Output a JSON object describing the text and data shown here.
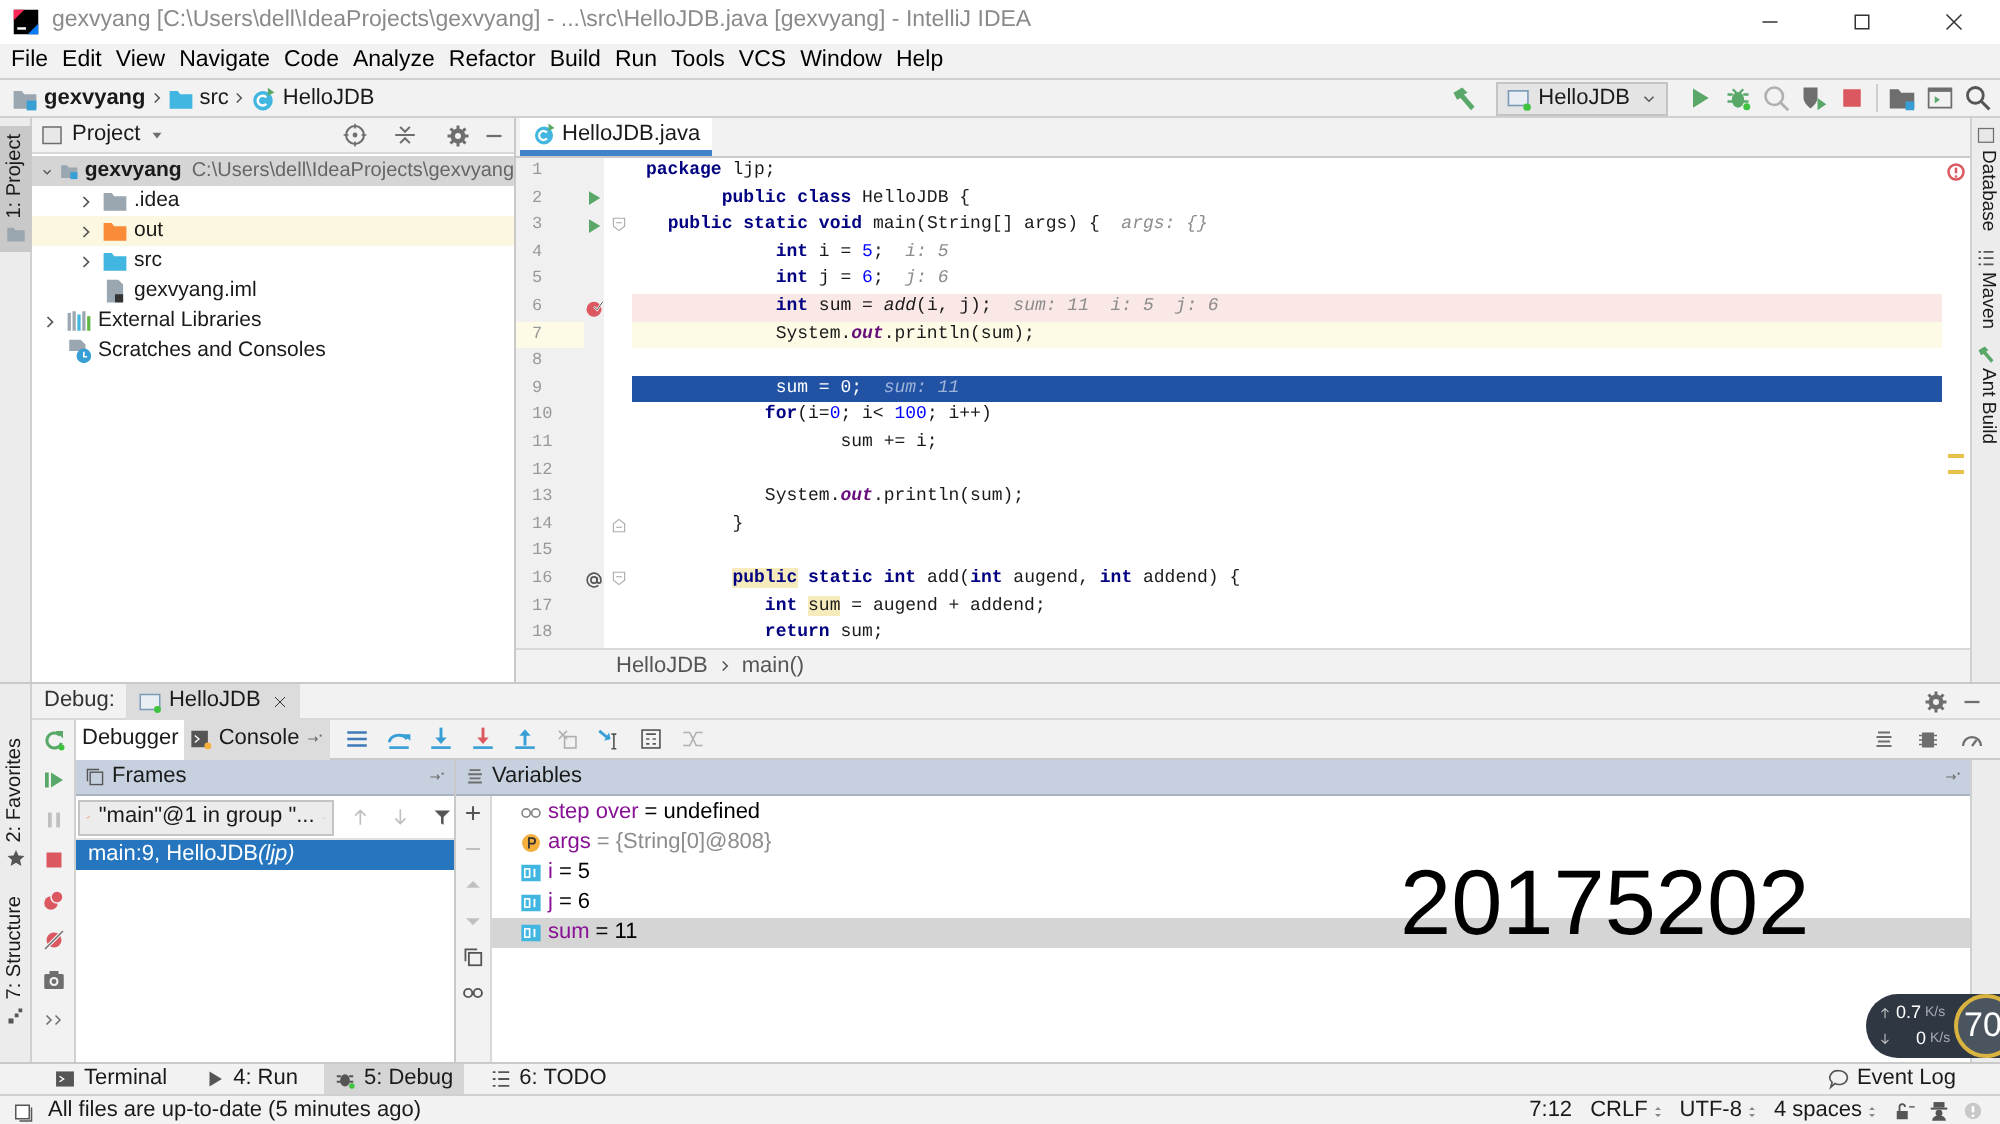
{
  "window": {
    "title": "gexvyang [C:\\Users\\dell\\IdeaProjects\\gexvyang] - ...\\src\\HelloJDB.java [gexvyang] - IntelliJ IDEA"
  },
  "menu": [
    "File",
    "Edit",
    "View",
    "Navigate",
    "Code",
    "Analyze",
    "Refactor",
    "Build",
    "Run",
    "Tools",
    "VCS",
    "Window",
    "Help"
  ],
  "breadcrumbs": [
    {
      "label": "gexvyang",
      "kind": "project"
    },
    {
      "label": "src",
      "kind": "folder"
    },
    {
      "label": "HelloJDB",
      "kind": "class"
    }
  ],
  "run_config": "HelloJDB",
  "left_stripe": {
    "top": [
      {
        "label": "1: Project",
        "selected": true
      }
    ],
    "bottom": [
      {
        "label": "2: Favorites",
        "selected": false
      },
      {
        "label": "7: Structure",
        "selected": false
      }
    ]
  },
  "right_stripe": [
    "Database",
    "Maven",
    "Ant Build"
  ],
  "project_panel": {
    "title": "Project",
    "tree": [
      {
        "label": "gexvyang",
        "path": "C:\\Users\\dell\\IdeaProjects\\gexvyang",
        "kind": "module",
        "expanded": true,
        "selected": true,
        "excluded": false,
        "children": [
          {
            "label": ".idea",
            "kind": "config",
            "expanded": false,
            "selected": false,
            "excluded": false
          },
          {
            "label": "out",
            "kind": "output",
            "expanded": false,
            "selected": false,
            "excluded": true
          },
          {
            "label": "src",
            "kind": "source",
            "expanded": false,
            "selected": false,
            "excluded": false
          },
          {
            "label": "gexvyang.iml",
            "kind": "file",
            "selected": false,
            "excluded": false
          }
        ]
      },
      {
        "label": "External Libraries",
        "kind": "libraries",
        "expanded": false,
        "selected": false,
        "excluded": false
      },
      {
        "label": "Scratches and Consoles",
        "kind": "scratches",
        "selected": false,
        "excluded": false
      }
    ]
  },
  "editor": {
    "tabs": [
      {
        "label": "HelloJDB.java",
        "selected": true
      }
    ],
    "lines": [
      {
        "number": "1",
        "kind": "plain",
        "tokens": [
          {
            "t": "package",
            "kind": "kw"
          },
          {
            "t": " ljp;",
            "kind": "txt"
          }
        ]
      },
      {
        "number": "2",
        "kind": "plain",
        "run_button": true,
        "tokens": [
          {
            "t": "       public class",
            "kind": "kw"
          },
          {
            "t": " HelloJDB {",
            "kind": "txt"
          }
        ]
      },
      {
        "number": "3",
        "kind": "plain",
        "run_button": true,
        "fold_start": true,
        "tokens": [
          {
            "t": "  public static void",
            "kind": "kw"
          },
          {
            "t": " main(String[] args) {",
            "kind": "txt"
          },
          {
            "t": "  args: {}",
            "kind": "hint"
          }
        ]
      },
      {
        "number": "4",
        "kind": "plain",
        "tokens": [
          {
            "t": "            int",
            "kind": "kw"
          },
          {
            "t": " i = ",
            "kind": "txt"
          },
          {
            "t": "5",
            "kind": "num"
          },
          {
            "t": ";",
            "kind": "txt"
          },
          {
            "t": "  i: 5",
            "kind": "hint"
          }
        ]
      },
      {
        "number": "5",
        "kind": "plain",
        "tokens": [
          {
            "t": "            int",
            "kind": "kw"
          },
          {
            "t": " j = ",
            "kind": "txt"
          },
          {
            "t": "6",
            "kind": "num"
          },
          {
            "t": ";",
            "kind": "txt"
          },
          {
            "t": "  j: 6",
            "kind": "hint"
          }
        ]
      },
      {
        "number": "6",
        "kind": "breakpoint",
        "tokens": [
          {
            "t": "            int",
            "kind": "kw"
          },
          {
            "t": " sum = ",
            "kind": "txt"
          },
          {
            "t": "add",
            "kind": "italic"
          },
          {
            "t": "(i, j);",
            "kind": "txt"
          },
          {
            "t": "  sum: 11  i: 5  j: 6",
            "kind": "hint"
          }
        ]
      },
      {
        "number": "7",
        "kind": "caret",
        "tokens": [
          {
            "t": "            System.",
            "kind": "txt"
          },
          {
            "t": "out",
            "kind": "field"
          },
          {
            "t": ".println(sum);",
            "kind": "txt"
          }
        ]
      },
      {
        "number": "8",
        "kind": "plain"
      },
      {
        "number": "9",
        "kind": "execution",
        "tokens": [
          {
            "t": "            sum = ",
            "kind": "txt"
          },
          {
            "t": "0",
            "kind": "num"
          },
          {
            "t": ";",
            "kind": "txt"
          },
          {
            "t": "  sum: 11",
            "kind": "hint"
          }
        ]
      },
      {
        "number": "10",
        "kind": "plain",
        "tokens": [
          {
            "t": "           for",
            "kind": "kw"
          },
          {
            "t": "(i=",
            "kind": "txt"
          },
          {
            "t": "0",
            "kind": "num"
          },
          {
            "t": "; i< ",
            "kind": "txt"
          },
          {
            "t": "100",
            "kind": "num"
          },
          {
            "t": "; i++)",
            "kind": "txt"
          }
        ]
      },
      {
        "number": "11",
        "kind": "plain",
        "tokens": [
          {
            "t": "                  sum += i;",
            "kind": "txt"
          }
        ]
      },
      {
        "number": "12",
        "kind": "plain"
      },
      {
        "number": "13",
        "kind": "plain",
        "tokens": [
          {
            "t": "           System.",
            "kind": "txt"
          },
          {
            "t": "out",
            "kind": "field"
          },
          {
            "t": ".println(sum);",
            "kind": "txt"
          }
        ]
      },
      {
        "number": "14",
        "kind": "plain",
        "fold_end": true,
        "tokens": [
          {
            "t": "        }",
            "kind": "txt"
          }
        ]
      },
      {
        "number": "15",
        "kind": "plain"
      },
      {
        "number": "16",
        "kind": "plain",
        "override_mark": true,
        "fold_start": true,
        "tokens": [
          {
            "t": "        public",
            "kind": "kw_marked"
          },
          {
            "t": " static int",
            "kind": "kw"
          },
          {
            "t": " add(",
            "kind": "txt"
          },
          {
            "t": "int",
            "kind": "kw"
          },
          {
            "t": " augend, ",
            "kind": "txt"
          },
          {
            "t": "int",
            "kind": "kw"
          },
          {
            "t": " addend) {",
            "kind": "txt"
          }
        ]
      },
      {
        "number": "17",
        "kind": "plain",
        "tokens": [
          {
            "t": "           int ",
            "kind": "kw"
          },
          {
            "t": "sum",
            "kind": "var_marked"
          },
          {
            "t": " = augend + addend;",
            "kind": "txt"
          }
        ]
      },
      {
        "number": "18",
        "kind": "plain",
        "tokens": [
          {
            "t": "           return",
            "kind": "kw"
          },
          {
            "t": " sum;",
            "kind": "txt"
          }
        ]
      }
    ],
    "breadcrumbs": [
      "HelloJDB",
      "main()"
    ]
  },
  "debug": {
    "label": "Debug:",
    "sessions": [
      {
        "label": "HelloJDB",
        "selected": true
      }
    ],
    "view_tabs": [
      {
        "label": "Debugger",
        "selected": true
      },
      {
        "label": "Console",
        "selected": false
      }
    ],
    "frames": {
      "title": "Frames",
      "thread": "\"main\"@1 in group \"...",
      "items": [
        {
          "method": "main:9, HelloJDB",
          "package": "(ljp)",
          "selected": true
        }
      ]
    },
    "variables": {
      "title": "Variables",
      "items": [
        {
          "kind": "watch",
          "name": "step over",
          "value": "= undefined",
          "selected": false
        },
        {
          "kind": "param",
          "name": "args",
          "value": "= {String[0]@808}",
          "selected": false
        },
        {
          "kind": "local",
          "name": "i",
          "value": "= 5",
          "selected": false
        },
        {
          "kind": "local",
          "name": "j",
          "value": "= 6",
          "selected": false
        },
        {
          "kind": "local",
          "name": "sum",
          "value": "= 11",
          "selected": true
        }
      ]
    }
  },
  "tool_tabs": [
    {
      "label": "Terminal",
      "kind": "terminal",
      "selected": false
    },
    {
      "label": "4: Run",
      "kind": "run",
      "selected": false
    },
    {
      "label": "5: Debug",
      "kind": "debug",
      "selected": true
    },
    {
      "label": "6: TODO",
      "kind": "todo",
      "selected": false
    }
  ],
  "event_log": "Event Log",
  "status_bar": {
    "message": "All files are up-to-date (5 minutes ago)",
    "position": "7:12",
    "line_separator": "CRLF",
    "encoding": "UTF-8",
    "indent": "4 spaces"
  },
  "overlay_number": "20175202",
  "net_monitor": {
    "upload": "0.7",
    "upload_unit": "K/s",
    "download": "0",
    "download_unit": "K/s",
    "gauge": "70"
  }
}
